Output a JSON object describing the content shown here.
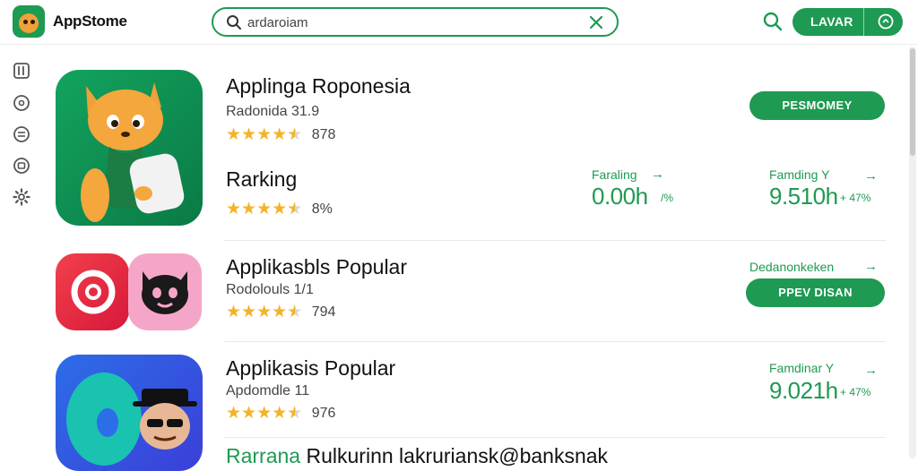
{
  "app": {
    "brand": "AppStome"
  },
  "search": {
    "value": "ardaroiam",
    "placeholder": ""
  },
  "top_bar": {
    "login_label": "LAVAR"
  },
  "apps": [
    {
      "title": "Applinga Roponesia",
      "subtitle": "Radonida 31.9",
      "rating": 4.5,
      "rating_count": "878",
      "action_label": "PESMOMEY"
    },
    {
      "title": "Applikasbls Popular",
      "subtitle": "Rodolouls 1/1",
      "rating": 4.5,
      "rating_count": "794",
      "action_label": "PPEV DISAN",
      "stat_label": "Dedanonkeken"
    },
    {
      "title": "Applikasis Popular",
      "subtitle": "Apdomdle 11",
      "rating": 4.5,
      "rating_count": "976",
      "stat_label": "Famdinar Y",
      "stat_value": "9.021h",
      "stat_pct": "+ 47%"
    }
  ],
  "ranking": {
    "title": "Rarking",
    "rating": 4.5,
    "rating_count": "8%",
    "stat1_label": "Faraling",
    "stat1_value": "0.00h",
    "stat1_pct": "/%",
    "stat2_label": "Famding Y",
    "stat2_value": "9.510h",
    "stat2_pct": "+ 47%"
  },
  "bottom_row": {
    "lead": "Rarrana",
    "rest": "Rulkurinn lakruriansk@banksnak"
  },
  "colors": {
    "accent": "#1e9a52",
    "star": "#f3b32a"
  },
  "icons": [
    "menu-icon",
    "help-icon",
    "list-icon",
    "account-icon",
    "gear-icon",
    "search-icon",
    "close-icon",
    "arrow-right-icon"
  ]
}
